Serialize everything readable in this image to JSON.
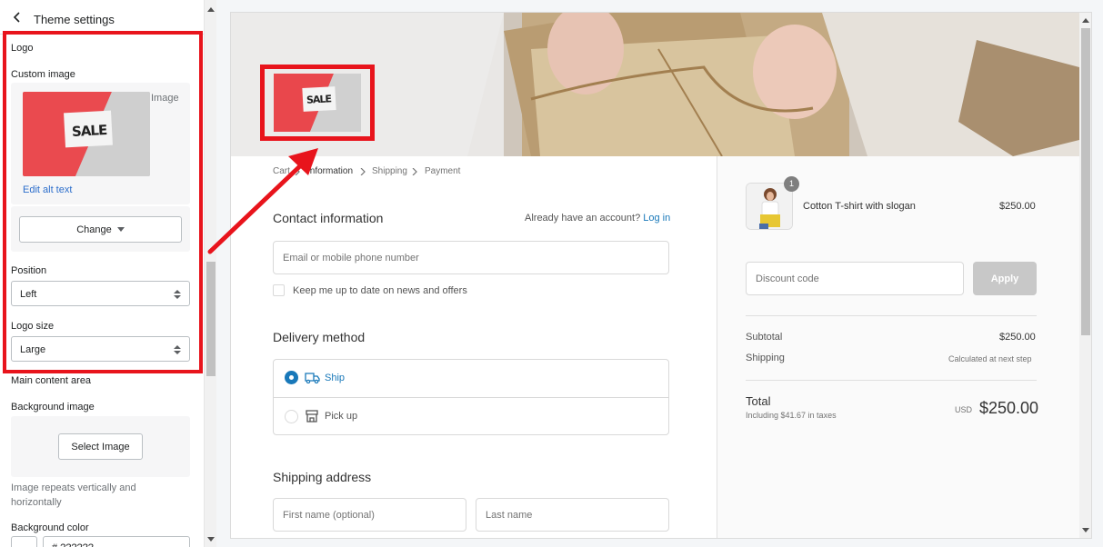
{
  "panel": {
    "title": "Theme settings",
    "logo_section": "Logo",
    "custom_image_label": "Custom image",
    "thumb_alt": "Image",
    "thumb_text": "SALE",
    "edit_alt_text": "Edit alt text",
    "change_button": "Change",
    "position_label": "Position",
    "position_value": "Left",
    "logo_size_label": "Logo size",
    "logo_size_value": "Large",
    "main_content_label": "Main content area",
    "background_image_label": "Background image",
    "select_image_button": "Select Image",
    "help_text": "Image repeats vertically and horizontally",
    "background_color_label": "Background color",
    "background_color_value": "# ??????"
  },
  "preview": {
    "logo_text": "SALE",
    "breadcrumb": [
      "Cart",
      "Information",
      "Shipping",
      "Payment"
    ],
    "contact": {
      "title": "Contact information",
      "account_prompt": "Already have an account?",
      "login_link": "Log in",
      "email_placeholder": "Email or mobile phone number",
      "newsletter_label": "Keep me up to date on news and offers"
    },
    "delivery": {
      "title": "Delivery method",
      "ship_label": "Ship",
      "pickup_label": "Pick up"
    },
    "shipping": {
      "title": "Shipping address",
      "first_name_placeholder": "First name (optional)",
      "last_name_placeholder": "Last name"
    },
    "summary": {
      "quantity_badge": "1",
      "product_name": "Cotton T-shirt with slogan",
      "product_price": "$250.00",
      "discount_placeholder": "Discount code",
      "apply_button": "Apply",
      "subtotal_label": "Subtotal",
      "subtotal_value": "$250.00",
      "shipping_label": "Shipping",
      "shipping_value": "Calculated at next step",
      "total_label": "Total",
      "taxes_note": "Including $41.67 in taxes",
      "currency": "USD",
      "total_value": "$250.00"
    }
  },
  "colors": {
    "annotation_red": "#e8141c",
    "link_blue": "#1878b9",
    "admin_link": "#2c6ecb"
  },
  "icons": [
    "back-chevron-icon",
    "caret-down-icon",
    "select-arrows-icon",
    "truck-icon",
    "store-icon",
    "breadcrumb-chevron-icon"
  ]
}
